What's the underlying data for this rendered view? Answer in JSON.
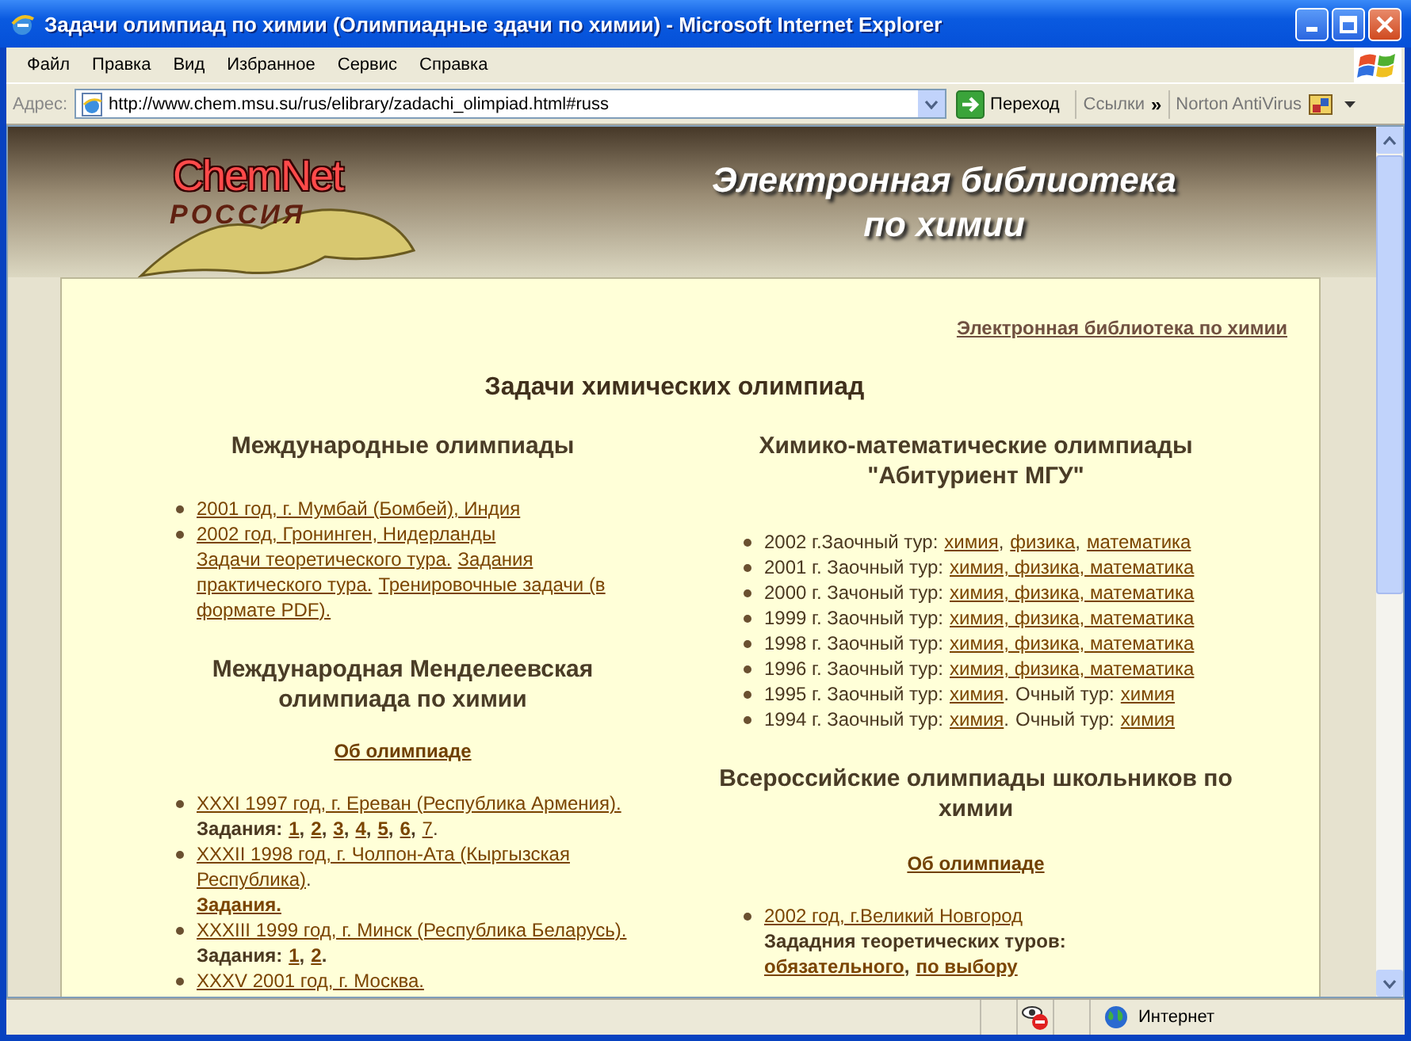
{
  "window": {
    "title": "Задачи олимпиад по химии (Олимпиадные здачи по химии) - Microsoft Internet Explorer"
  },
  "menu": [
    "Файл",
    "Правка",
    "Вид",
    "Избранное",
    "Сервис",
    "Справка"
  ],
  "address_bar": {
    "label": "Адрес:",
    "url": "http://www.chem.msu.su/rus/elibrary/zadachi_olimpiad.html#russ",
    "go": "Переход",
    "links": "Ссылки",
    "chevron": "»",
    "toolbar": "Norton AntiVirus"
  },
  "banner": {
    "logo_top": "ChemNet",
    "logo_bottom": "РОССИЯ",
    "title_lines": [
      "Электронная библиотека",
      "по химии"
    ]
  },
  "top_link": "Электронная библиотека по химии",
  "page_title": "Задачи химических олимпиад",
  "columns": [
    {
      "sections": [
        {
          "heading": "Международные олимпиады",
          "items": [
            {
              "lines": [
                [
                  {
                    "kind": "link",
                    "text": "2001 год, г. Мумбай (Бомбей), Индия"
                  }
                ]
              ]
            },
            {
              "lines": [
                [
                  {
                    "kind": "link",
                    "text": "2002 год, Гронинген, Нидерланды"
                  }
                ],
                [
                  {
                    "kind": "link",
                    "text": "Задачи теоретического тура."
                  },
                  {
                    "kind": "space"
                  },
                  {
                    "kind": "link",
                    "text": "Задания"
                  }
                ],
                [
                  {
                    "kind": "link",
                    "text": "практического тура."
                  },
                  {
                    "kind": "space"
                  },
                  {
                    "kind": "link",
                    "text": "Тренировочные задачи (в"
                  }
                ],
                [
                  {
                    "kind": "link",
                    "text": "формате PDF)."
                  }
                ]
              ]
            }
          ]
        },
        {
          "heading": "Международная Менделеевская олимпиада по химии",
          "about": "Об олимпиаде",
          "items": [
            {
              "lines": [
                [
                  {
                    "kind": "link",
                    "text": "XXXI 1997 год, г. Ереван (Республика Армения)."
                  }
                ],
                [
                  {
                    "kind": "bold",
                    "text": "Задания:"
                  },
                  {
                    "kind": "space"
                  },
                  {
                    "kind": "boldlink",
                    "text": "1"
                  },
                  {
                    "kind": "bold",
                    "text": ","
                  },
                  {
                    "kind": "space"
                  },
                  {
                    "kind": "boldlink",
                    "text": "2"
                  },
                  {
                    "kind": "bold",
                    "text": ","
                  },
                  {
                    "kind": "space"
                  },
                  {
                    "kind": "boldlink",
                    "text": "3"
                  },
                  {
                    "kind": "bold",
                    "text": ","
                  },
                  {
                    "kind": "space"
                  },
                  {
                    "kind": "boldlink",
                    "text": "4"
                  },
                  {
                    "kind": "bold",
                    "text": ","
                  },
                  {
                    "kind": "space"
                  },
                  {
                    "kind": "boldlink",
                    "text": "5"
                  },
                  {
                    "kind": "bold",
                    "text": ","
                  },
                  {
                    "kind": "space"
                  },
                  {
                    "kind": "boldlink",
                    "text": "6"
                  },
                  {
                    "kind": "bold",
                    "text": ","
                  },
                  {
                    "kind": "space"
                  },
                  {
                    "kind": "link",
                    "text": "7"
                  },
                  {
                    "kind": "text",
                    "text": "."
                  }
                ]
              ]
            },
            {
              "lines": [
                [
                  {
                    "kind": "link",
                    "text": "XXXII 1998 год, г. Чолпон-Ата (Кыргызская"
                  }
                ],
                [
                  {
                    "kind": "link",
                    "text": "Республика)"
                  },
                  {
                    "kind": "text",
                    "text": "."
                  }
                ],
                [
                  {
                    "kind": "boldlink",
                    "text": "Задания."
                  }
                ]
              ]
            },
            {
              "lines": [
                [
                  {
                    "kind": "link",
                    "text": "XXXIII 1999 год, г. Минск (Республика Беларусь)."
                  }
                ],
                [
                  {
                    "kind": "bold",
                    "text": "Задания:"
                  },
                  {
                    "kind": "space"
                  },
                  {
                    "kind": "boldlink",
                    "text": "1"
                  },
                  {
                    "kind": "bold",
                    "text": ","
                  },
                  {
                    "kind": "space"
                  },
                  {
                    "kind": "boldlink",
                    "text": "2"
                  },
                  {
                    "kind": "bold",
                    "text": "."
                  }
                ]
              ]
            },
            {
              "lines": [
                [
                  {
                    "kind": "link",
                    "text": "XXXV 2001 год, г. Москва."
                  }
                ]
              ]
            }
          ]
        }
      ]
    },
    {
      "sections": [
        {
          "heading": "Химико-математические олимпиады \"Абитуриент МГУ\"",
          "items": [
            {
              "lines": [
                [
                  {
                    "kind": "text",
                    "text": "2002 г.Заочный тур:"
                  },
                  {
                    "kind": "space"
                  },
                  {
                    "kind": "link",
                    "text": "химия"
                  },
                  {
                    "kind": "text",
                    "text": ","
                  },
                  {
                    "kind": "space"
                  },
                  {
                    "kind": "link",
                    "text": "физика"
                  },
                  {
                    "kind": "text",
                    "text": ","
                  },
                  {
                    "kind": "space"
                  },
                  {
                    "kind": "link",
                    "text": "математика"
                  }
                ]
              ]
            },
            {
              "lines": [
                [
                  {
                    "kind": "text",
                    "text": "2001 г. Заочный тур:"
                  },
                  {
                    "kind": "space"
                  },
                  {
                    "kind": "link",
                    "text": "химия, физика, математика"
                  }
                ]
              ]
            },
            {
              "lines": [
                [
                  {
                    "kind": "text",
                    "text": "2000 г. Зачоный тур:"
                  },
                  {
                    "kind": "space"
                  },
                  {
                    "kind": "link",
                    "text": "химия, физика, математика"
                  }
                ]
              ]
            },
            {
              "lines": [
                [
                  {
                    "kind": "text",
                    "text": "1999 г. Заочный тур:"
                  },
                  {
                    "kind": "space"
                  },
                  {
                    "kind": "link",
                    "text": "химия, физика, математика"
                  }
                ]
              ]
            },
            {
              "lines": [
                [
                  {
                    "kind": "text",
                    "text": "1998 г. Заочный тур:"
                  },
                  {
                    "kind": "space"
                  },
                  {
                    "kind": "link",
                    "text": "химия, физика, математика"
                  }
                ]
              ]
            },
            {
              "lines": [
                [
                  {
                    "kind": "text",
                    "text": "1996 г. Заочный тур:"
                  },
                  {
                    "kind": "space"
                  },
                  {
                    "kind": "link",
                    "text": "химия, физика, математика"
                  }
                ]
              ]
            },
            {
              "lines": [
                [
                  {
                    "kind": "text",
                    "text": "1995 г. Заочный тур:"
                  },
                  {
                    "kind": "space"
                  },
                  {
                    "kind": "link",
                    "text": "химия"
                  },
                  {
                    "kind": "text",
                    "text": "."
                  },
                  {
                    "kind": "space"
                  },
                  {
                    "kind": "text",
                    "text": "Очный тур:"
                  },
                  {
                    "kind": "space"
                  },
                  {
                    "kind": "link",
                    "text": "химия"
                  }
                ]
              ]
            },
            {
              "lines": [
                [
                  {
                    "kind": "text",
                    "text": "1994 г. Заочный тур:"
                  },
                  {
                    "kind": "space"
                  },
                  {
                    "kind": "link",
                    "text": "химия"
                  },
                  {
                    "kind": "text",
                    "text": "."
                  },
                  {
                    "kind": "space"
                  },
                  {
                    "kind": "text",
                    "text": "Очный тур:"
                  },
                  {
                    "kind": "space"
                  },
                  {
                    "kind": "link",
                    "text": "химия"
                  }
                ]
              ]
            }
          ]
        },
        {
          "heading": "Всероссийские олимпиады школьников по химии",
          "about": "Об олимпиаде",
          "items": [
            {
              "lines": [
                [
                  {
                    "kind": "link",
                    "text": "2002 год, г.Великий Новгород"
                  }
                ],
                [
                  {
                    "kind": "bold",
                    "text": "Зададния теоретических туров:"
                  }
                ],
                [
                  {
                    "kind": "boldlink",
                    "text": "обязательного"
                  },
                  {
                    "kind": "bold",
                    "text": ","
                  },
                  {
                    "kind": "space"
                  },
                  {
                    "kind": "boldlink",
                    "text": "по выбору"
                  }
                ]
              ]
            }
          ]
        }
      ]
    }
  ],
  "status_bar": {
    "zone": "Интернет"
  }
}
